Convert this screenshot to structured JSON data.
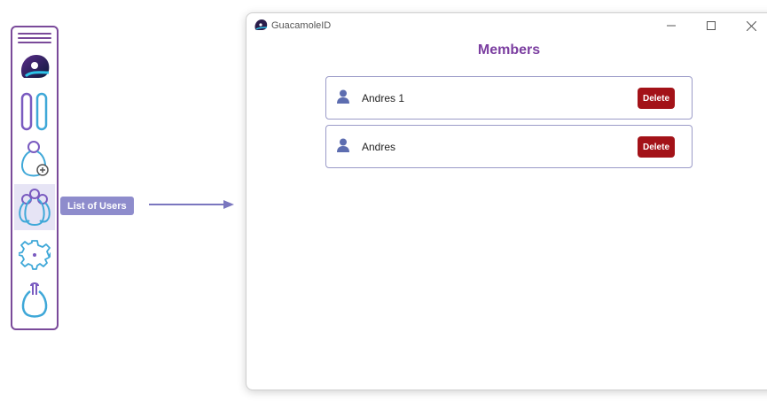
{
  "tooltip": {
    "label": "List of Users"
  },
  "window": {
    "title": "GuacamoleID",
    "page_title": "Members"
  },
  "members": [
    {
      "name": "Andres 1",
      "delete_label": "Delete"
    },
    {
      "name": "Andres",
      "delete_label": "Delete"
    }
  ],
  "sidebar": {
    "items": [
      {
        "icon": "app-logo-icon"
      },
      {
        "icon": "pause-icon"
      },
      {
        "icon": "add-user-icon"
      },
      {
        "icon": "list-of-users-icon",
        "active": true
      },
      {
        "icon": "gear-icon"
      },
      {
        "icon": "logout-icon"
      }
    ]
  },
  "colors": {
    "accent": "#7a4a9a",
    "title": "#7b3ea0",
    "delete": "#a31218",
    "tooltip": "#8e8ccc",
    "card_border": "#9b9bc8"
  }
}
